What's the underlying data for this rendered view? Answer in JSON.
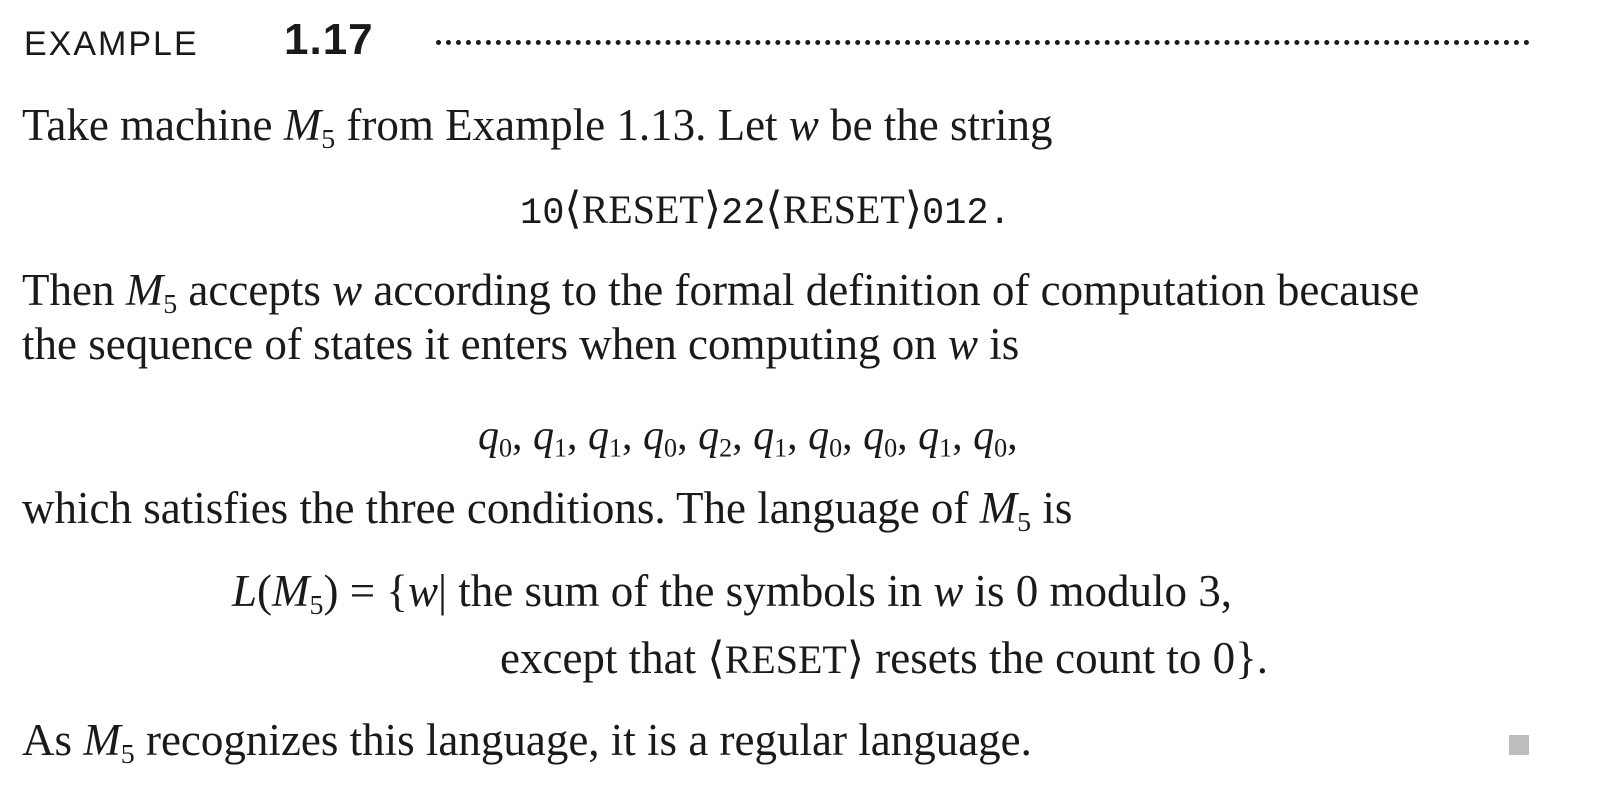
{
  "example": {
    "label": "EXAMPLE",
    "number": "1.17"
  },
  "para1": {
    "text_a": "Take machine ",
    "machine": "M",
    "machine_sub": "5",
    "text_b": " from Example 1.13. Let ",
    "var_w": "w",
    "text_c": " be the string"
  },
  "display1": {
    "part1": "10",
    "lang": "⟨",
    "reset": "RESET",
    "rang": "⟩",
    "part2": "22",
    "part3": "012."
  },
  "para2": {
    "line1_a": "Then ",
    "machine": "M",
    "machine_sub": "5",
    "line1_b": " accepts ",
    "var_w": "w",
    "line1_c": " according to the formal definition of computation because",
    "line2_a": "the sequence of states it enters when computing on ",
    "line2_b": " is"
  },
  "states": {
    "q": "q",
    "seq": [
      "0",
      "1",
      "1",
      "0",
      "2",
      "1",
      "0",
      "0",
      "1",
      "0"
    ],
    "sep": ", ",
    "end": ","
  },
  "para3": {
    "text_a": "which satisfies the three conditions. The language of ",
    "machine": "M",
    "machine_sub": "5",
    "text_b": " is"
  },
  "language_def": {
    "L": "L",
    "open": "(",
    "machine": "M",
    "machine_sub": "5",
    "close_eq": ") = {",
    "var_w": "w",
    "bar": "|",
    "line1_rest": " the sum of the symbols in ",
    "line1_end": " is 0 modulo 3,",
    "line2_a": "except that ",
    "lang": "⟨",
    "reset": "RESET",
    "rang": "⟩",
    "line2_b": " resets the count to 0}."
  },
  "para4": {
    "text_a": "As ",
    "machine": "M",
    "machine_sub": "5",
    "text_b": " recognizes this language, it is a regular language."
  }
}
